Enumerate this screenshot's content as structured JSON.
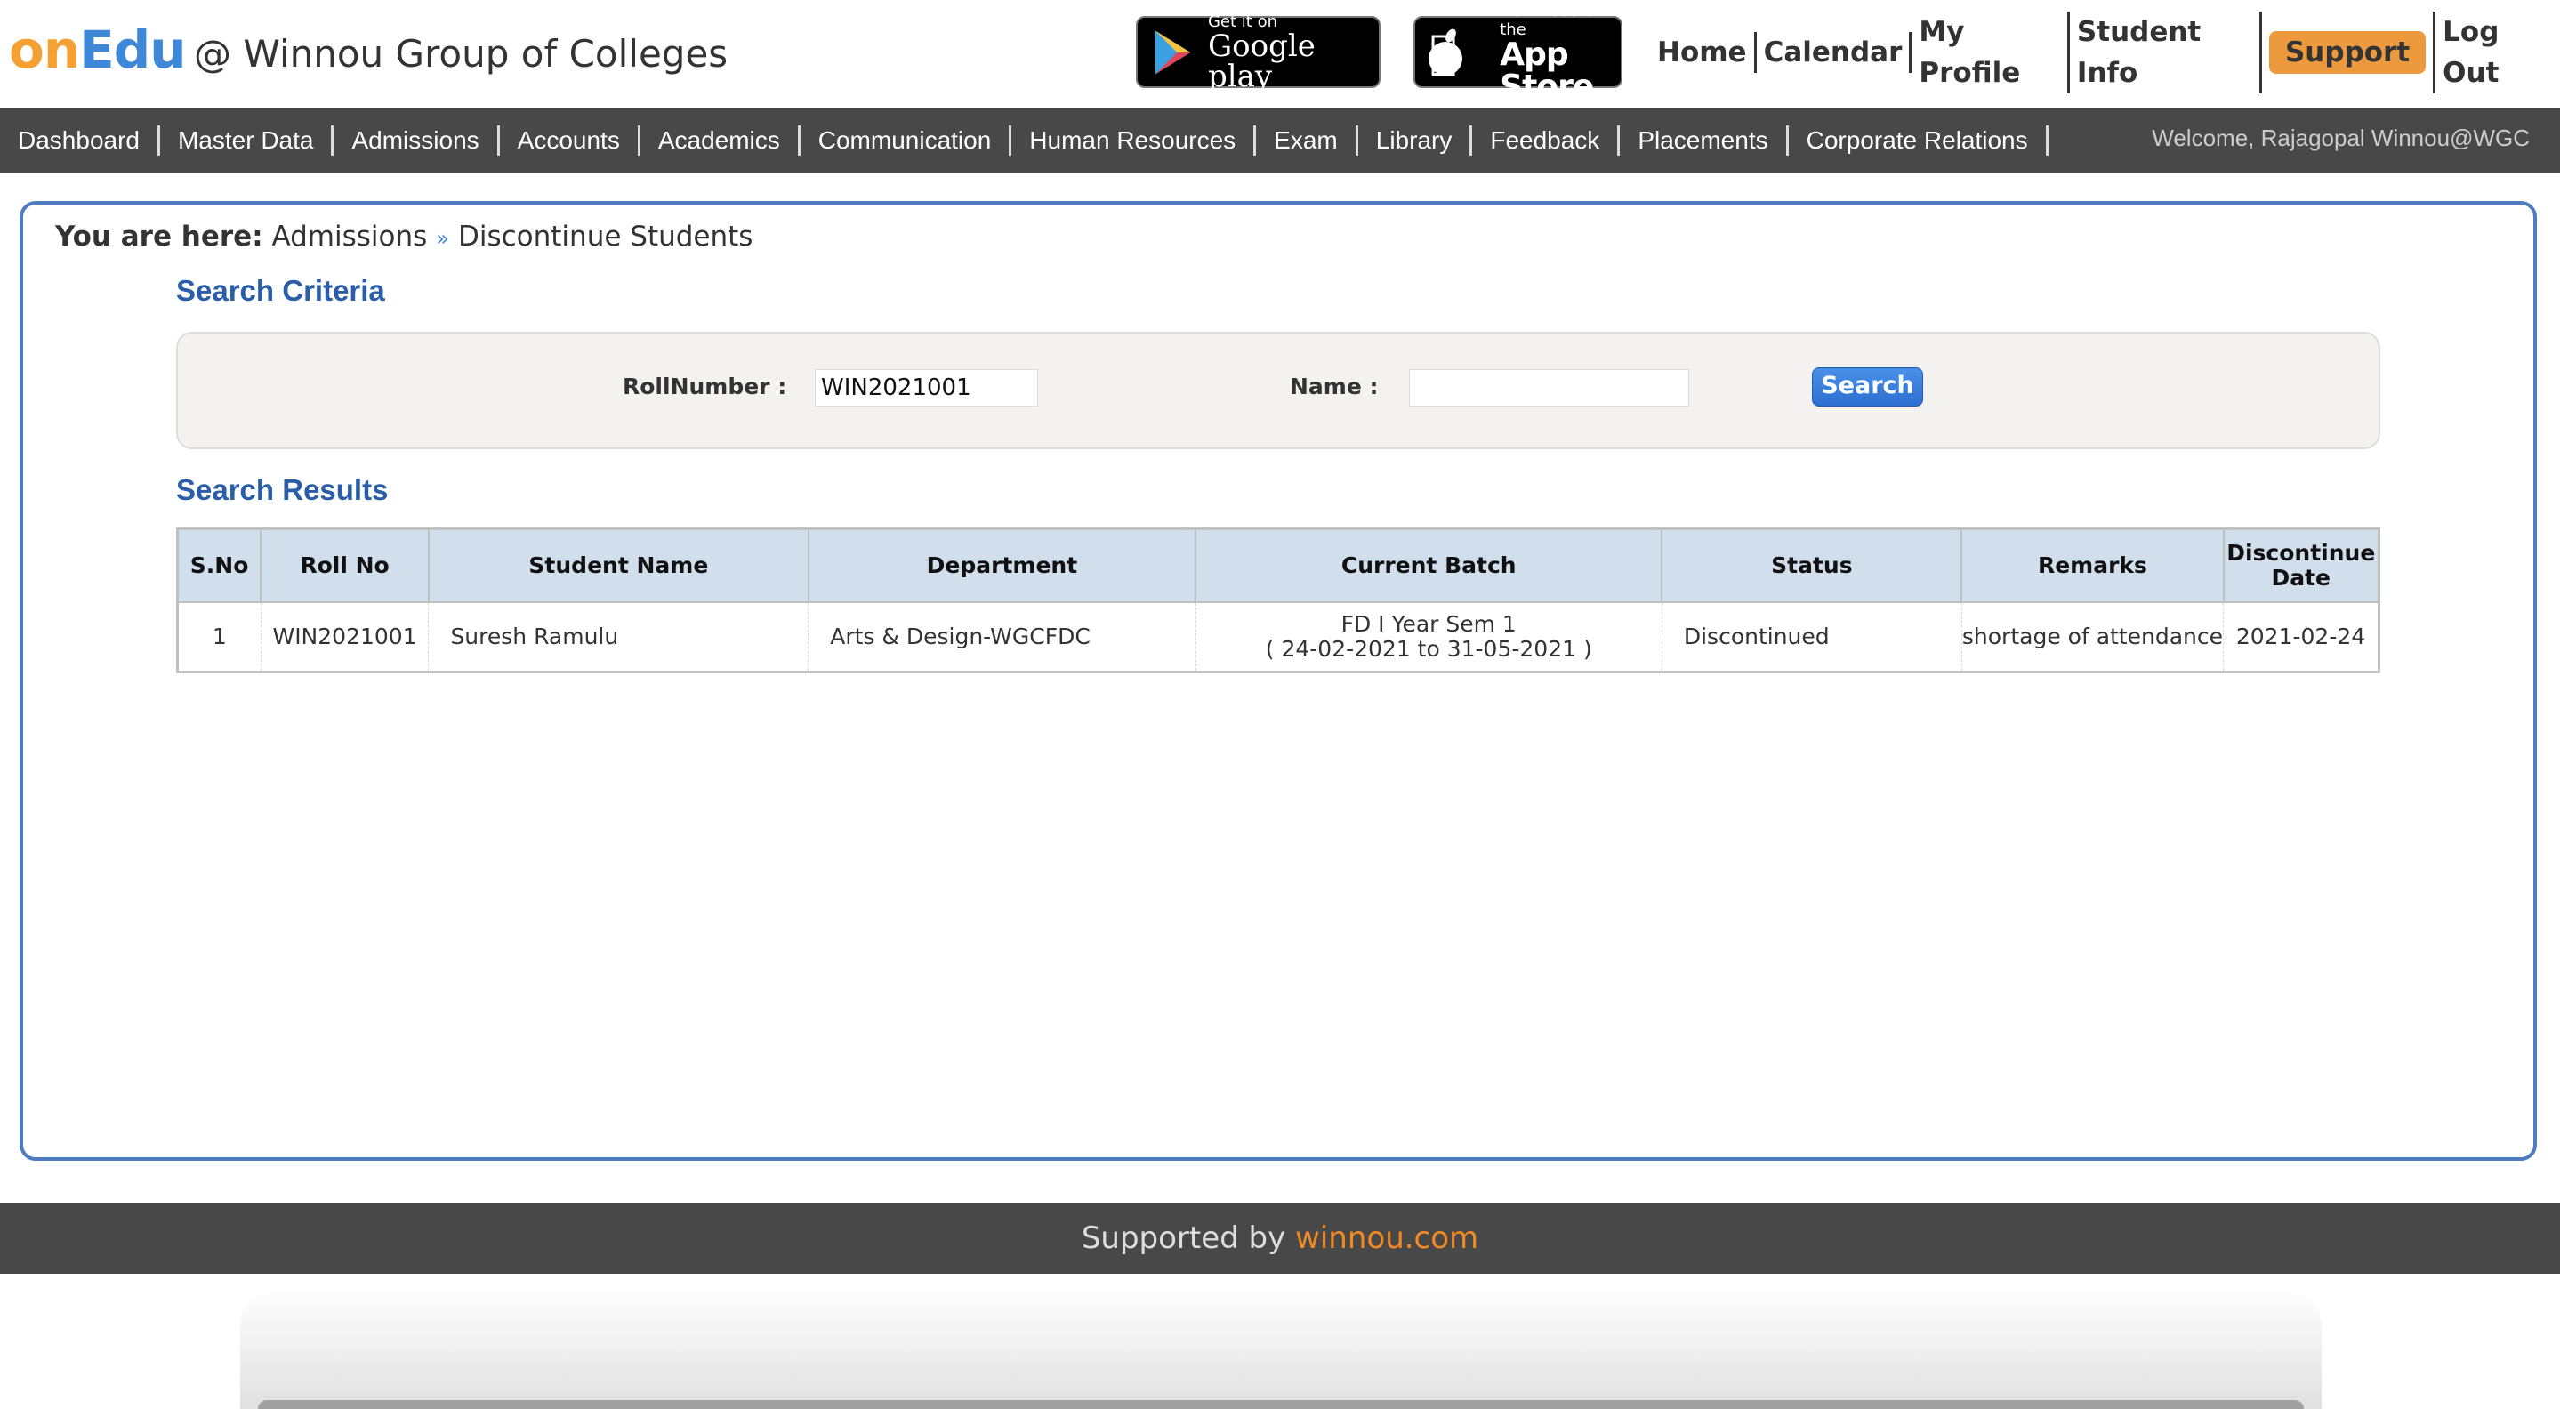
{
  "header": {
    "logo_on": "on",
    "logo_edu": "Edu",
    "institution": "@ Winnou Group of Colleges",
    "google_play": {
      "small": "Get it on",
      "big": "Google play"
    },
    "app_store": {
      "small": "Download on the",
      "big": "App Store"
    },
    "links": [
      "Home",
      "Calendar",
      "My Profile",
      "Student Info",
      "Support",
      "Log Out"
    ],
    "support_color": "#ec9a3d"
  },
  "nav": {
    "items": [
      "Dashboard",
      "Master Data",
      "Admissions",
      "Accounts",
      "Academics",
      "Communication",
      "Human Resources",
      "Exam",
      "Library",
      "Feedback",
      "Placements",
      "Corporate Relations"
    ],
    "welcome": "Welcome, Rajagopal Winnou@WGC"
  },
  "breadcrumb": {
    "prefix": "You are here:",
    "items": [
      "Admissions",
      "Discontinue Students"
    ],
    "separator": "»"
  },
  "search_criteria": {
    "title": "Search Criteria",
    "roll_label": "RollNumber :",
    "roll_value": "WIN2021001",
    "name_label": "Name :",
    "name_value": "",
    "button": "Search"
  },
  "results": {
    "title": "Search Results",
    "columns": [
      "S.No",
      "Roll No",
      "Student Name",
      "Department",
      "Current Batch",
      "Status",
      "Remarks",
      "Discontinue Date"
    ],
    "rows": [
      {
        "sno": "1",
        "roll": "WIN2021001",
        "name": "Suresh Ramulu",
        "department": "Arts & Design-WGCFDC",
        "batch": "FD I Year Sem 1",
        "batch_range": "( 24-02-2021 to 31-05-2021 )",
        "status": "Discontinued",
        "remarks": "shortage of attendance",
        "date": "2021-02-24"
      }
    ]
  },
  "footer": {
    "text": "Supported by ",
    "link": "winnou.com"
  }
}
